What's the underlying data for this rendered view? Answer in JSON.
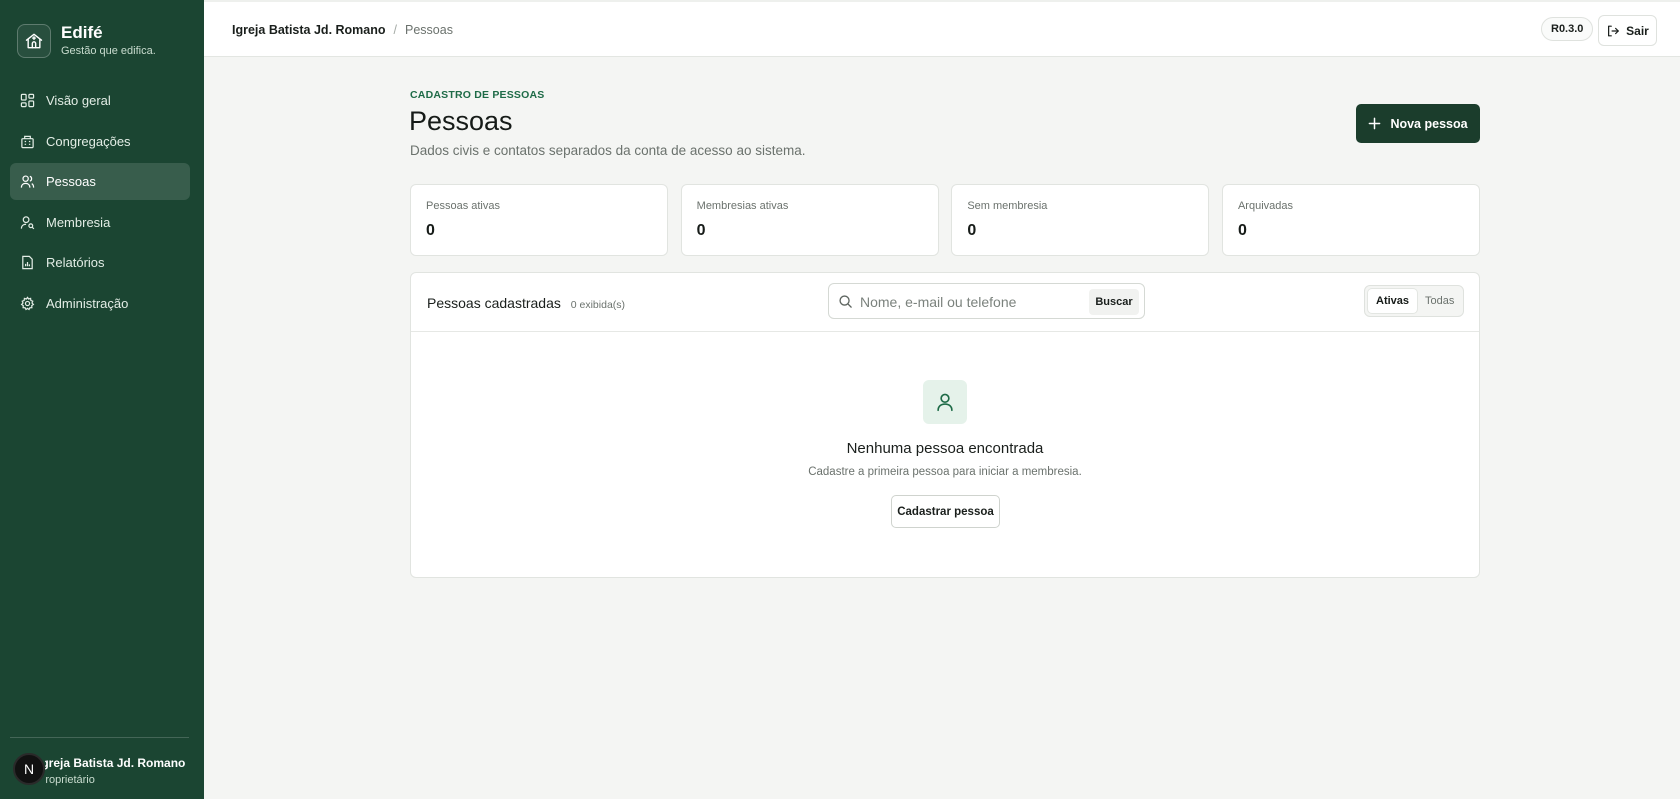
{
  "brand": {
    "name": "Edifé",
    "tagline": "Gestão que edifica.",
    "logo_icon": "church-house-icon"
  },
  "sidebar": {
    "items": [
      {
        "label": "Visão geral",
        "icon": "grid-icon",
        "active": false
      },
      {
        "label": "Congregações",
        "icon": "building-icon",
        "active": false
      },
      {
        "label": "Pessoas",
        "icon": "users-icon",
        "active": true
      },
      {
        "label": "Membresia",
        "icon": "user-key-icon",
        "active": false
      },
      {
        "label": "Relatórios",
        "icon": "report-icon",
        "active": false
      },
      {
        "label": "Administração",
        "icon": "gear-icon",
        "active": false
      }
    ],
    "user": {
      "avatar_letter": "N",
      "name": "Igreja Batista Jd. Romano",
      "role": "Proprietário"
    }
  },
  "header": {
    "org": "Igreja Batista Jd. Romano",
    "separator": "/",
    "page": "Pessoas",
    "version": "R0.3.0",
    "logout_label": "Sair"
  },
  "main": {
    "eyebrow": "CADASTRO DE PESSOAS",
    "title": "Pessoas",
    "description": "Dados civis e contatos separados da conta de acesso ao sistema.",
    "new_button": "Nova pessoa",
    "stats": [
      {
        "label": "Pessoas ativas",
        "value": "0"
      },
      {
        "label": "Membresias ativas",
        "value": "0"
      },
      {
        "label": "Sem membresia",
        "value": "0"
      },
      {
        "label": "Arquivadas",
        "value": "0"
      }
    ],
    "panel": {
      "title": "Pessoas cadastradas",
      "count": "0 exibida(s)",
      "search_placeholder": "Nome, e-mail ou telefone",
      "search_value": "",
      "search_button": "Buscar",
      "filters": [
        {
          "label": "Ativas",
          "selected": true
        },
        {
          "label": "Todas",
          "selected": false
        }
      ],
      "empty": {
        "title": "Nenhuma pessoa encontrada",
        "subtitle": "Cadastre a primeira pessoa para iniciar a membresia.",
        "button": "Cadastrar pessoa"
      }
    }
  },
  "colors": {
    "sidebar": "#1b4532",
    "primary_button": "#1b3d2c",
    "accent": "#1e6b47",
    "background": "#f4f5f3"
  }
}
